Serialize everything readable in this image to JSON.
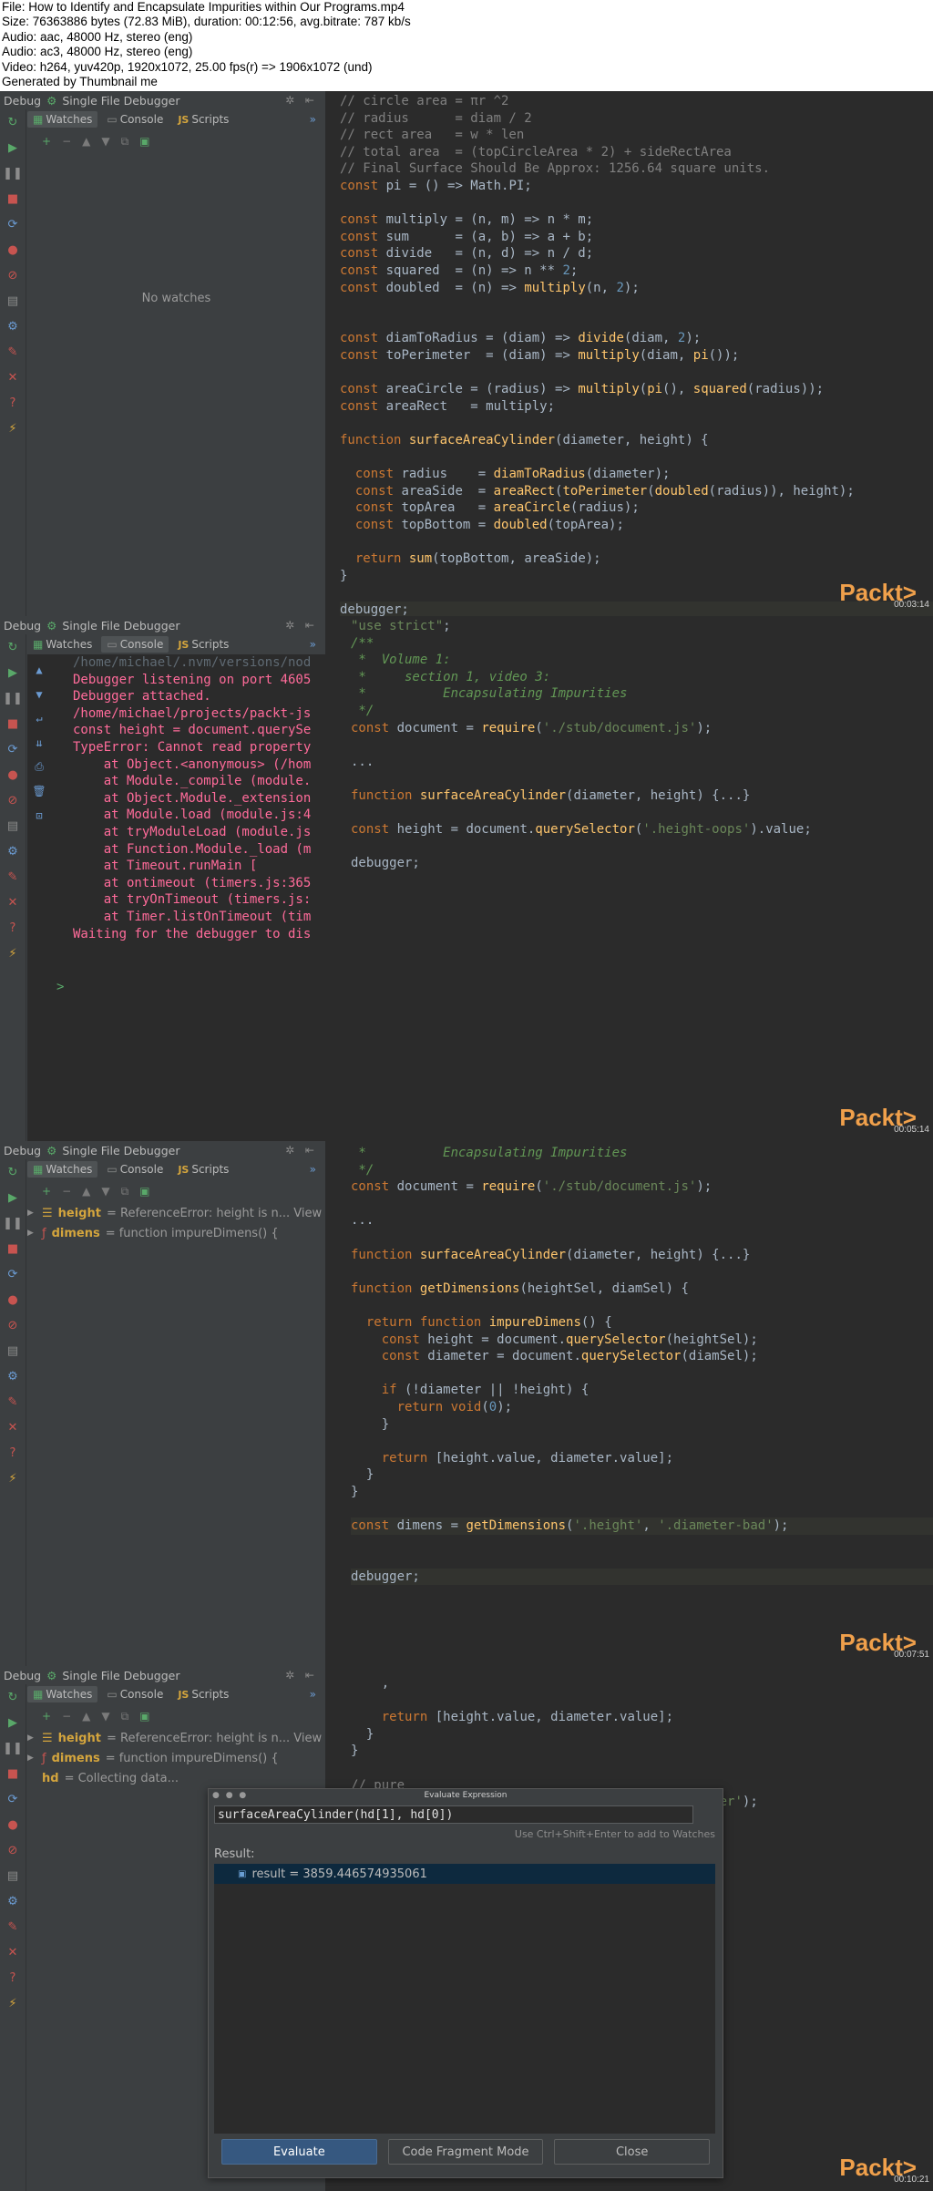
{
  "header": {
    "file": "File: How to Identify and Encapsulate Impurities within Our Programs.mp4",
    "size": "Size: 76363886 bytes (72.83 MiB), duration: 00:12:56, avg.bitrate: 787 kb/s",
    "audio1": "Audio: aac, 48000 Hz, stereo (eng)",
    "audio2": "Audio: ac3, 48000 Hz, stereo (eng)",
    "video": "Video: h264, yuv420p, 1920x1072, 25.00 fps(r) => 1906x1072 (und)",
    "generated": "Generated by Thumbnail me"
  },
  "ide": {
    "debug_title": "Debug",
    "debugger_name": "Single File Debugger",
    "tab_watches": "Watches",
    "tab_console": "Console",
    "tab_scripts": "Scripts",
    "tab_js_badge": "JS",
    "no_watches": "No watches",
    "brand": "Packt>",
    "colors": {
      "accent": "#f0a04b",
      "keyword": "#cc7832",
      "function": "#ffc66d",
      "string": "#6a8759",
      "number": "#6897bb",
      "comment": "#808080",
      "console_error": "#ff6b9a"
    }
  },
  "frames": [
    {
      "timecode": "00:03:14",
      "code": [
        "// circle area = πr ^2",
        "// radius      = diam / 2",
        "// rect area   = w * len",
        "// total area  = (topCircleArea * 2) + sideRectArea",
        "// Final Surface Should Be Approx: 1256.64 square units.",
        "const pi = () => Math.PI;",
        "",
        "const multiply = (n, m) => n * m;",
        "const sum      = (a, b) => a + b;",
        "const divide   = (n, d) => n / d;",
        "const squared  = (n) => n ** 2;",
        "const doubled  = (n) => multiply(n, 2);",
        "",
        "",
        "const diamToRadius = (diam) => divide(diam, 2);",
        "const toPerimeter  = (diam) => multiply(diam, pi());",
        "",
        "const areaCircle = (radius) => multiply(pi(), squared(radius));",
        "const areaRect   = multiply;",
        "",
        "function surfaceAreaCylinder(diameter, height) {",
        "",
        "  const radius    = diamToRadius(diameter);",
        "  const areaSide  = areaRect(toPerimeter(doubled(radius)), height);",
        "  const topArea   = areaCircle(radius);",
        "  const topBottom = doubled(topArea);",
        "",
        "  return sum(topBottom, areaSide);",
        "}",
        "",
        "debugger;"
      ]
    },
    {
      "timecode": "00:05:14",
      "console": [
        "/home/michael/.nvm/versions/nod",
        "Debugger listening on port 4605",
        "Debugger attached.",
        "/home/michael/projects/packt-js",
        "const height = document.querySe",
        "",
        "TypeError: Cannot read property",
        "    at Object.<anonymous> (/hom",
        "    at Module._compile (module.",
        "    at Object.Module._extension",
        "    at Module.load (module.js:4",
        "    at tryModuleLoad (module.js",
        "    at Function.Module._load (m",
        "    at Timeout.runMain [",
        "    at ontimeout (timers.js:365",
        "    at tryOnTimeout (timers.js:",
        "    at Timer.listOnTimeout (tim",
        "Waiting for the debugger to dis"
      ],
      "prompt": ">",
      "code": [
        "\"use strict\";",
        "/**",
        " *  Volume 1:",
        " *     section 1, video 3:",
        " *          Encapsulating Impurities",
        " */",
        "const document = require('./stub/document.js');",
        "",
        "...",
        "",
        "function surfaceAreaCylinder(diameter, height) {...}",
        "",
        "const height = document.querySelector('.height-oops').value;",
        "",
        "debugger;"
      ]
    },
    {
      "timecode": "00:07:51",
      "watches": [
        {
          "name": "height",
          "value": "= ReferenceError: height is n... View"
        },
        {
          "name": "dimens",
          "value": "= function impureDimens() {"
        }
      ],
      "code": [
        " *          Encapsulating Impurities",
        " */",
        "const document = require('./stub/document.js');",
        "",
        "...",
        "",
        "function surfaceAreaCylinder(diameter, height) {...}",
        "",
        "function getDimensions(heightSel, diamSel) {",
        "",
        "  return function impureDimens() {",
        "    const height = document.querySelector(heightSel);",
        "    const diameter = document.querySelector(diamSel);",
        "",
        "    if (!diameter || !height) {",
        "      return void(0);",
        "    }",
        "",
        "    return [height.value, diameter.value];",
        "  }",
        "}",
        "",
        "const dimens = getDimensions('.height', '.diameter-bad');",
        "",
        "",
        "debugger;"
      ]
    },
    {
      "timecode": "00:10:21",
      "watches": [
        {
          "name": "height",
          "value": "= ReferenceError: height is n... View"
        },
        {
          "name": "dimens",
          "value": "= function impureDimens() {"
        },
        {
          "name": "hd",
          "value": "= Collecting data..."
        }
      ],
      "code": [
        "    ,",
        "",
        "    return [height.value, diameter.value];",
        "  }",
        "}",
        "",
        "// pure",
        "const dimens = getDimensions('.height', '.diameter');"
      ],
      "dialog": {
        "title": "Evaluate Expression",
        "expression": "surfaceAreaCylinder(hd[1], hd[0])",
        "hint": "Use Ctrl+Shift+Enter to add to Watches",
        "result_label": "Result:",
        "result": "result = 3859.446574935061",
        "btn_evaluate": "Evaluate",
        "btn_fragment": "Code Fragment Mode",
        "btn_close": "Close"
      }
    }
  ]
}
